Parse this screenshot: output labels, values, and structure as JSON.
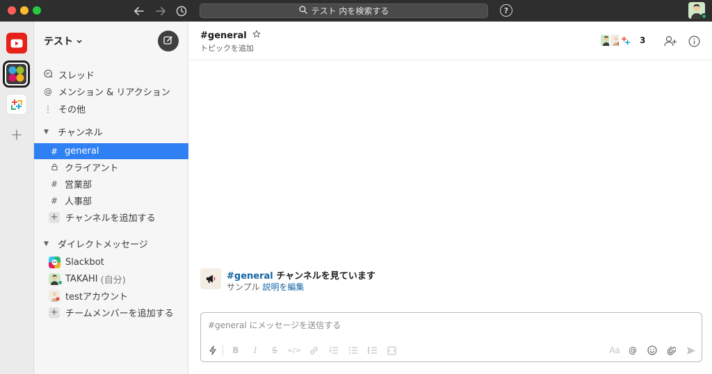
{
  "titlebar": {
    "search_placeholder": "テスト 内を検索する",
    "help_label": "?"
  },
  "rail": {
    "add_label": "+"
  },
  "sidebar": {
    "workspace_name": "テスト",
    "nav_items": [
      {
        "label": "スレッド",
        "icon": "threads-icon"
      },
      {
        "label": "メンション & リアクション",
        "icon": "at-icon"
      },
      {
        "label": "その他",
        "icon": "more-vertical-icon"
      }
    ],
    "channels_header": "チャンネル",
    "channels": [
      {
        "label": "general",
        "prefix": "#",
        "active": true
      },
      {
        "label": "クライアント",
        "prefix": "🔒",
        "active": false
      },
      {
        "label": "営業部",
        "prefix": "#",
        "active": false
      },
      {
        "label": "人事部",
        "prefix": "#",
        "active": false
      }
    ],
    "add_channel": "チャンネルを追加する",
    "dm_header": "ダイレクトメッセージ",
    "dms": [
      {
        "label": "Slackbot",
        "suffix": ""
      },
      {
        "label": "TAKAHI",
        "suffix": "(自分)"
      },
      {
        "label": "testアカウント",
        "suffix": ""
      }
    ],
    "add_member": "チームメンバーを追加する"
  },
  "header": {
    "channel_name": "#general",
    "topic": "トピックを追加",
    "member_count": "3"
  },
  "intro": {
    "channel_link": "#general",
    "title_rest": " チャンネルを見ています",
    "sub_text": "サンプル",
    "edit_link": "説明を編集"
  },
  "composer": {
    "placeholder": "#general にメッセージを送信する",
    "format_label": "Aa"
  },
  "colors": {
    "titlebar": "#2e2e2e",
    "active_channel": "#2f80f3",
    "link": "#1264a3",
    "presence": "#2bac76"
  }
}
